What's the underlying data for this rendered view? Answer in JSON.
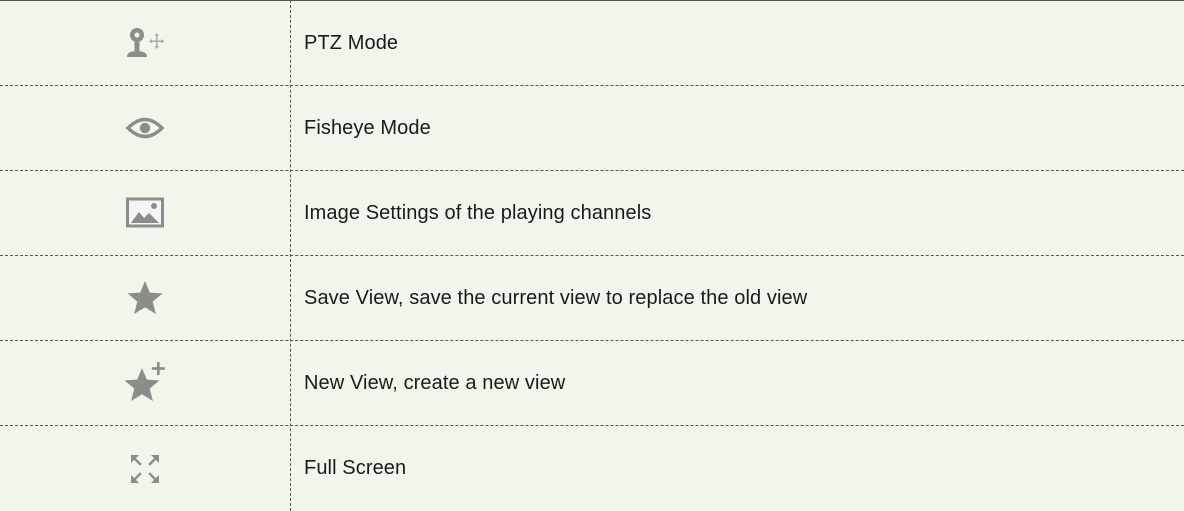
{
  "rows": [
    {
      "icon": "ptz-joystick-icon",
      "label": "PTZ Mode"
    },
    {
      "icon": "eye-icon",
      "label": "Fisheye Mode"
    },
    {
      "icon": "image-settings-icon",
      "label": "Image Settings of the playing channels"
    },
    {
      "icon": "star-icon",
      "label": "Save View, save the current view to replace the old view"
    },
    {
      "icon": "star-plus-icon",
      "label": "New View, create a new view"
    },
    {
      "icon": "fullscreen-arrows-icon",
      "label": "Full Screen"
    }
  ],
  "colors": {
    "background": "#eff6ec",
    "icon": "#8c8c8c",
    "rule": "#555555"
  }
}
